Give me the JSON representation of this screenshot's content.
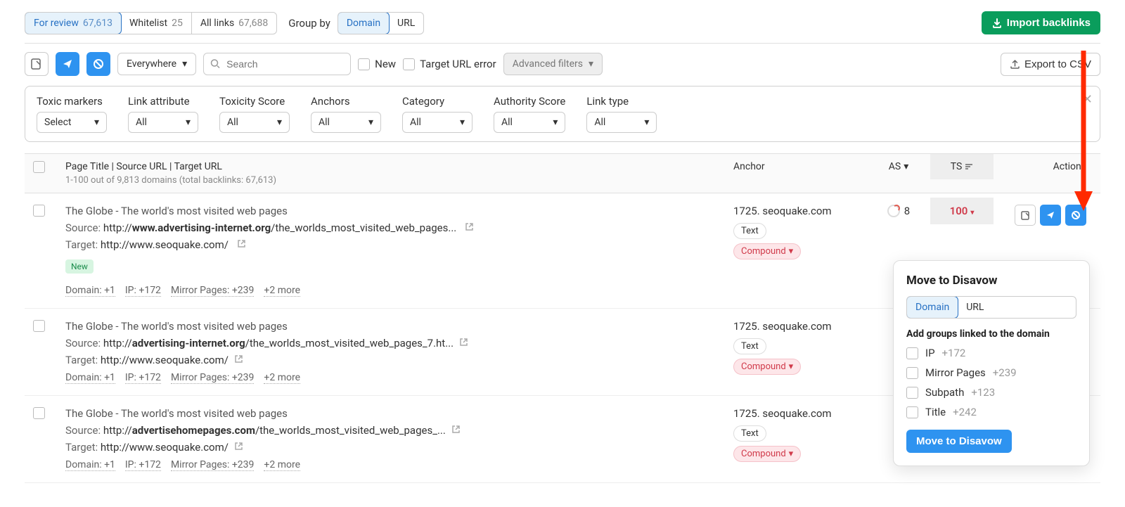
{
  "tabs": [
    {
      "label": "For review",
      "count": "67,613",
      "active": true
    },
    {
      "label": "Whitelist",
      "count": "25",
      "active": false
    },
    {
      "label": "All links",
      "count": "67,688",
      "active": false
    }
  ],
  "group_by": {
    "label": "Group by",
    "options": [
      "Domain",
      "URL"
    ],
    "selected": "Domain"
  },
  "import_button": "Import backlinks",
  "toolbar": {
    "everywhere": "Everywhere",
    "search_placeholder": "Search",
    "new_label": "New",
    "target_url_error": "Target URL error",
    "advanced_filters": "Advanced filters",
    "export_csv": "Export to CSV"
  },
  "filters": [
    {
      "label": "Toxic markers",
      "value": "Select"
    },
    {
      "label": "Link attribute",
      "value": "All"
    },
    {
      "label": "Toxicity Score",
      "value": "All"
    },
    {
      "label": "Anchors",
      "value": "All"
    },
    {
      "label": "Category",
      "value": "All"
    },
    {
      "label": "Authority Score",
      "value": "All"
    },
    {
      "label": "Link type",
      "value": "All"
    }
  ],
  "table_head": {
    "main": "Page Title | Source URL | Target URL",
    "sub": "1-100 out of 9,813 domains (total backlinks: 67,613)",
    "anchor": "Anchor",
    "as": "AS",
    "ts": "TS",
    "actions": "Actions"
  },
  "rows": [
    {
      "title": "The Globe - The world's most visited web pages",
      "source_label": "Source:",
      "source_prefix": "http://",
      "source_bold": "www.advertising-internet.org",
      "source_rest": "/the_worlds_most_visited_web_pages...",
      "target_label": "Target:",
      "target_url": "http://www.seoquake.com/",
      "badge_new": "New",
      "meta": [
        "Domain: +1",
        "IP: +172",
        "Mirror Pages: +239",
        "+2 more"
      ],
      "anchor": "1725. seoquake.com",
      "anchor_tags": [
        "Text",
        "Compound"
      ],
      "as": "8",
      "ts": "100"
    },
    {
      "title": "The Globe - The world's most visited web pages",
      "source_label": "Source:",
      "source_prefix": "http://",
      "source_bold": "advertising-internet.org",
      "source_rest": "/the_worlds_most_visited_web_pages_7.ht...",
      "target_label": "Target:",
      "target_url": "http://www.seoquake.com/",
      "meta": [
        "Domain: +1",
        "IP: +172",
        "Mirror Pages: +239",
        "+2 more"
      ],
      "anchor": "1725. seoquake.com",
      "anchor_tags": [
        "Text",
        "Compound"
      ]
    },
    {
      "title": "The Globe - The world's most visited web pages",
      "source_label": "Source:",
      "source_prefix": "http://",
      "source_bold": "advertisehomepages.com",
      "source_rest": "/the_worlds_most_visited_web_pages_...",
      "target_label": "Target:",
      "target_url": "http://www.seoquake.com/",
      "meta": [
        "Domain: +1",
        "IP: +172",
        "Mirror Pages: +239",
        "+2 more"
      ],
      "anchor": "1725. seoquake.com",
      "anchor_tags": [
        "Text",
        "Compound"
      ]
    }
  ],
  "popover": {
    "title": "Move to Disavow",
    "seg": [
      "Domain",
      "URL"
    ],
    "seg_selected": "Domain",
    "subhead": "Add groups linked to the domain",
    "groups": [
      {
        "label": "IP",
        "count": "+172"
      },
      {
        "label": "Mirror Pages",
        "count": "+239"
      },
      {
        "label": "Subpath",
        "count": "+123"
      },
      {
        "label": "Title",
        "count": "+242"
      }
    ],
    "button": "Move to Disavow"
  }
}
